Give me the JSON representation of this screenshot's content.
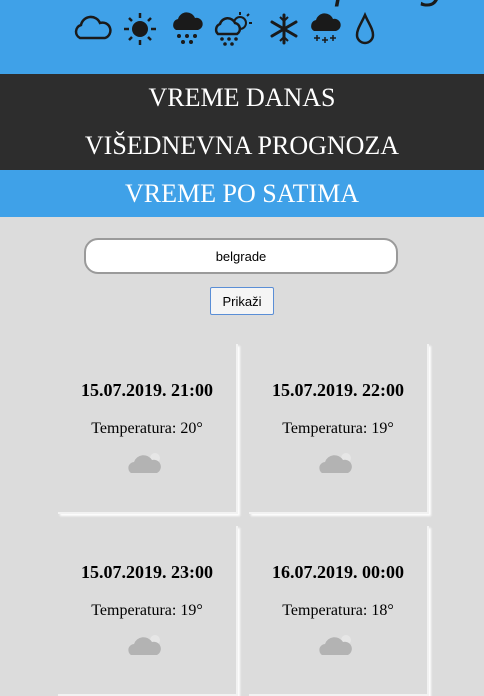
{
  "header": {
    "logo_text": "vremenska prognoza",
    "icons": [
      "cloud-icon",
      "sun-icon",
      "rain-cloud-icon",
      "sun-rain-cloud-icon",
      "snowflake-icon",
      "snow-cloud-icon",
      "raindrop-icon"
    ]
  },
  "nav": {
    "items": [
      {
        "label": "VREME DANAS"
      },
      {
        "label": "VIŠEDNEVNA PROGNOZA"
      },
      {
        "label": "VREME PO SATIMA"
      }
    ],
    "active": "VREME PO SATIMA"
  },
  "search": {
    "value": "belgrade",
    "button_label": "Prikaži"
  },
  "forecast": [
    {
      "datetime": "15.07.2019. 21:00",
      "temperature": "Temperatura: 20°",
      "icon": "cloud-icon"
    },
    {
      "datetime": "15.07.2019. 22:00",
      "temperature": "Temperatura: 19°",
      "icon": "cloud-icon"
    },
    {
      "datetime": "15.07.2019. 23:00",
      "temperature": "Temperatura: 19°",
      "icon": "cloud-icon"
    },
    {
      "datetime": "16.07.2019. 00:00",
      "temperature": "Temperatura: 18°",
      "icon": "cloud-icon"
    }
  ],
  "colors": {
    "header_blue": "#3fa1e8",
    "nav_dark": "#2d2d2d",
    "page_bg": "#dcdcdc"
  }
}
